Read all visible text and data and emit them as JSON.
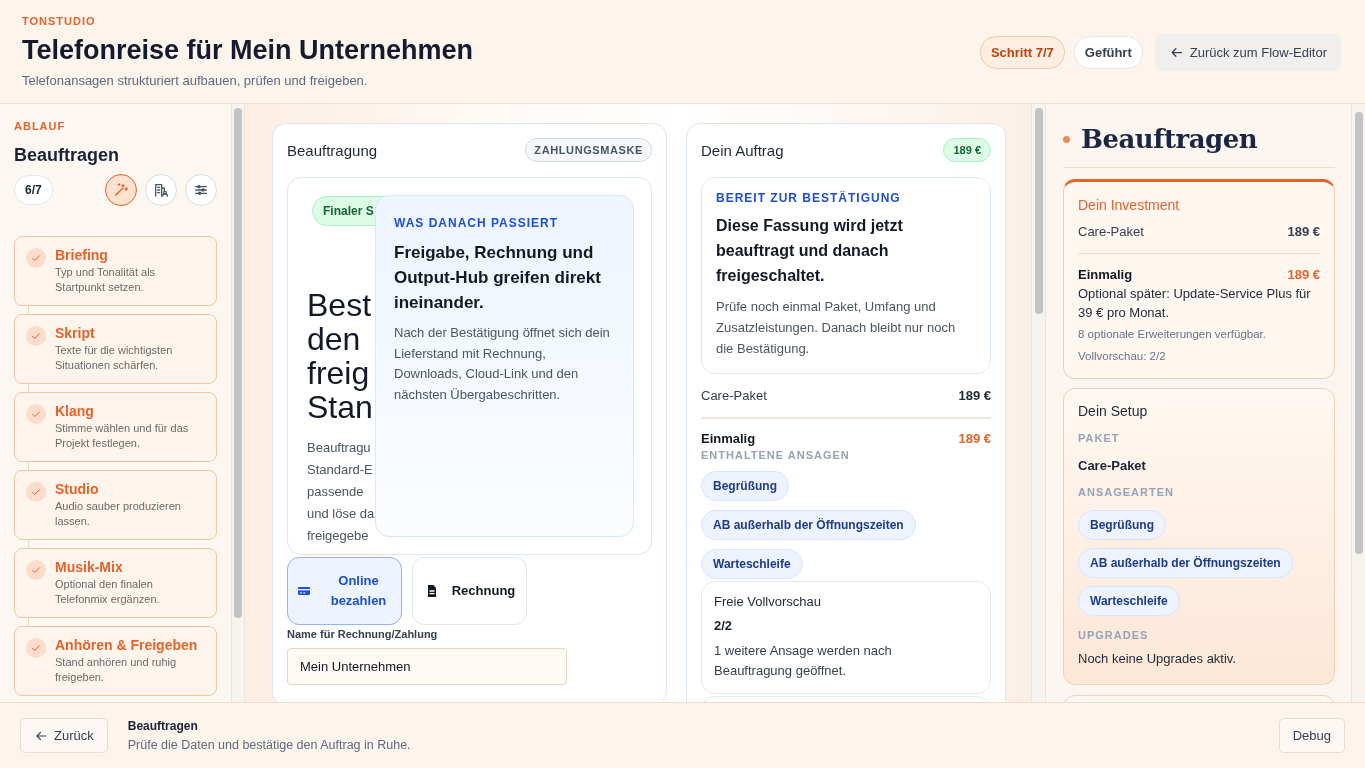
{
  "header": {
    "eyebrow": "TONSTUDIO",
    "title": "Telefonreise für Mein Unternehmen",
    "subtitle": "Telefonansagen strukturiert aufbauen, prüfen und freigeben.",
    "step_badge": "Schritt 7/7",
    "mode_badge": "Geführt",
    "back_button": "Zurück zum Flow-Editor"
  },
  "sidebar": {
    "eyebrow": "ABLAUF",
    "title": "Beauftragen",
    "progress": "6/7",
    "tools": [
      {
        "kind": "wand",
        "selected": true
      },
      {
        "kind": "building",
        "selected": false
      },
      {
        "kind": "sliders",
        "selected": false
      }
    ],
    "steps": [
      {
        "title": "Briefing",
        "description": "Typ und Tonalität als Startpunkt setzen.",
        "done": true
      },
      {
        "title": "Skript",
        "description": "Texte für die wichtigsten Situationen schärfen.",
        "done": true
      },
      {
        "title": "Klang",
        "description": "Stimme wählen und für das Projekt festlegen.",
        "done": true
      },
      {
        "title": "Studio",
        "description": "Audio sauber produzieren lassen.",
        "done": true
      },
      {
        "title": "Musik-Mix",
        "description": "Optional den finalen Telefonmix ergänzen.",
        "done": true
      },
      {
        "title": "Anhören & Freigeben",
        "description": "Stand anhören und ruhig freigeben.",
        "done": true
      }
    ]
  },
  "payment_card": {
    "title": "Beauftragung",
    "badge": "ZAHLUNGSMASKE",
    "chips": [
      {
        "label": "Finaler S",
        "kind": "success"
      }
    ],
    "headline_lines": [
      "Best",
      "den",
      "freig",
      "Stan"
    ],
    "text_lines": [
      "Beauftragu",
      "Standard-E",
      "passende",
      "und löse da",
      "freigegebe"
    ],
    "overlay": {
      "eyebrow": "WAS DANACH PASSIERT",
      "title": "Freigabe, Rechnung und Output-Hub greifen direkt ineinander.",
      "text": "Nach der Bestätigung öffnet sich dein Lieferstand mit Rechnung, Downloads, Cloud-Link und den nächsten Übergabeschritten."
    },
    "methods": [
      {
        "label": "Online bezahlen",
        "kind": "card",
        "selected": true
      },
      {
        "label": "Rechnung",
        "kind": "invoice",
        "selected": false
      }
    ],
    "name_label": "Name für Rechnung/Zahlung",
    "name_value": "Mein Unternehmen"
  },
  "order_card": {
    "title": "Dein Auftrag",
    "badge": "189 €",
    "notice": {
      "eyebrow": "BEREIT ZUR BESTÄTIGUNG",
      "title": "Diese Fassung wird jetzt beauftragt und danach freigeschaltet.",
      "text": "Prüfe noch einmal Paket, Umfang und Zusatzleistungen. Danach bleibt nur noch die Bestätigung."
    },
    "lines": [
      {
        "label": "Care-Paket",
        "amount": "189 €",
        "kind": "item"
      },
      {
        "label": "Einmalig",
        "amount": "189 €",
        "kind": "total"
      }
    ],
    "included_label": "ENTHALTENE ANSAGEN",
    "included": [
      "Begrüßung",
      "AB außerhalb der Öffnungszeiten",
      "Warteschleife"
    ],
    "preview": {
      "title": "Freie Vollvorschau",
      "count": "2/2",
      "text": "1 weitere Ansage werden nach Beauftragung geöffnet."
    }
  },
  "summary": {
    "title": "Beauftragen",
    "investment": {
      "title": "Dein Investment",
      "lines": [
        {
          "label": "Care-Paket",
          "amount": "189 €",
          "kind": "item"
        },
        {
          "label": "Einmalig",
          "amount": "189 €",
          "kind": "total"
        }
      ],
      "note": "Optional später: Update-Service Plus für 39 € pro Monat.",
      "extras": "8 optionale Erweiterungen verfügbar.",
      "preview": "Vollvorschau: 2/2"
    },
    "setup": {
      "title": "Dein Setup",
      "package_label": "PAKET",
      "package": "Care-Paket",
      "types_label": "ANSAGEARTEN",
      "types": [
        "Begrüßung",
        "AB außerhalb der Öffnungszeiten",
        "Warteschleife"
      ],
      "upgrades_label": "UPGRADES",
      "upgrades": "Noch keine Upgrades aktiv."
    }
  },
  "footer": {
    "back_button": "Zurück",
    "title": "Beauftragen",
    "text": "Prüfe die Daten und bestätige den Auftrag in Ruhe.",
    "debug_button": "Debug"
  }
}
